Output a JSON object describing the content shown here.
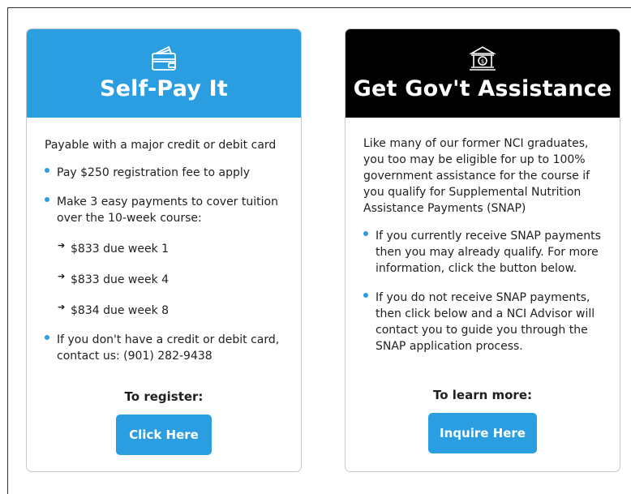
{
  "self_pay": {
    "icon": "wallet-icon",
    "title": "Self-Pay It",
    "intro": "Payable with a major credit or debit card",
    "items": [
      "Pay $250 registration fee to apply",
      "Make 3 easy payments to cover tuition over the 10-week course:"
    ],
    "payments": [
      "$833 due week 1",
      "$833 due week 4",
      "$834 due week 8"
    ],
    "note": "If you don't have a credit or debit card, contact us: (901) 282-9438",
    "cta_label": "To register:",
    "button_label": "Click Here"
  },
  "gov_assist": {
    "icon": "bank-icon",
    "title": "Get Gov't Assistance",
    "intro": "Like many of our former NCI graduates, you too may be eligible for up to 100% government assistance for the course if you qualify for Supplemental Nutrition Assistance Payments (SNAP)",
    "items": [
      "If you currently receive SNAP payments then you may already qualify. For more information, click the button below.",
      "If you do not receive SNAP payments, then click below and a NCI Advisor will contact you to guide you through the SNAP application process."
    ],
    "cta_label": "To learn more:",
    "button_label": "Inquire Here"
  },
  "colors": {
    "accent": "#2a9ee0",
    "dark_header": "#000000",
    "text": "#1f1f1f"
  }
}
